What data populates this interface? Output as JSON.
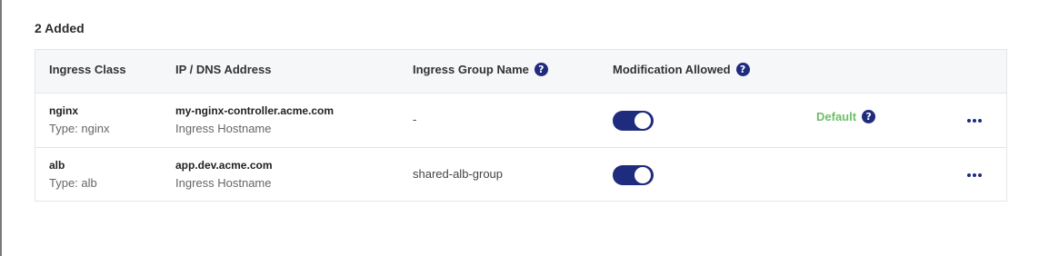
{
  "section": {
    "count_title": "2 Added"
  },
  "table": {
    "headers": {
      "ingress_class": "Ingress Class",
      "address": "IP / DNS Address",
      "group_name": "Ingress Group Name",
      "modification": "Modification Allowed"
    },
    "rows": [
      {
        "class_name": "nginx",
        "class_type": "Type: nginx",
        "address": "my-nginx-controller.acme.com",
        "address_type": "Ingress Hostname",
        "group_name": "-",
        "modification_allowed": true,
        "default_label": "Default"
      },
      {
        "class_name": "alb",
        "class_type": "Type: alb",
        "address": "app.dev.acme.com",
        "address_type": "Ingress Hostname",
        "group_name": "shared-alb-group",
        "modification_allowed": true
      }
    ]
  },
  "icons": {
    "help": "?",
    "more": "more-horizontal-icon"
  },
  "colors": {
    "accent": "#1f2b7d",
    "default_green": "#6cbf6a"
  }
}
